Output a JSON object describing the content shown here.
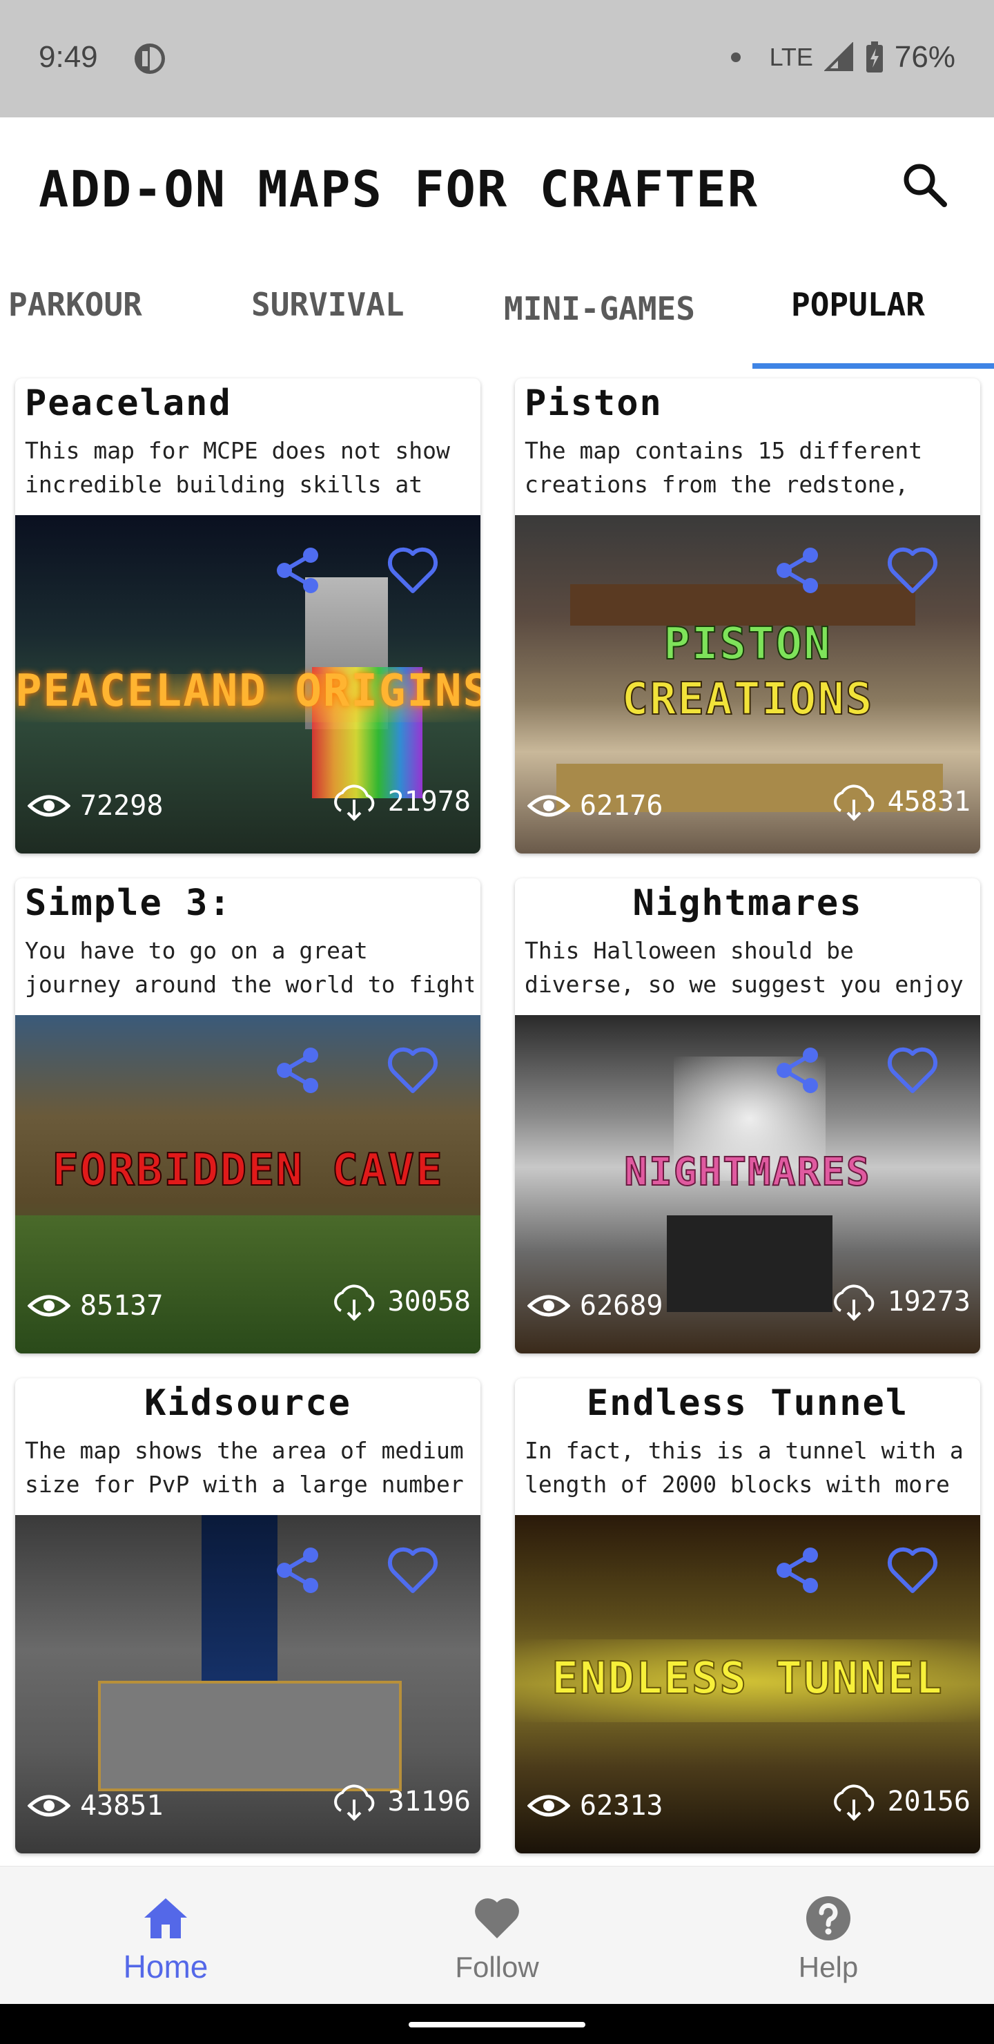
{
  "status_bar": {
    "time": "9:49",
    "network": "LTE",
    "battery": "76%"
  },
  "header": {
    "title": "ADD-ON MAPS FOR CRAFTER"
  },
  "tabs": [
    {
      "label": "PARKOUR",
      "active": false
    },
    {
      "label": "SURVIVAL",
      "active": false
    },
    {
      "label": "MINI-GAMES",
      "active": false
    },
    {
      "label": "POPULAR",
      "active": true
    }
  ],
  "accent_color": "#3f84e5",
  "icon_color": "#4f6df0",
  "cards": [
    {
      "title": "Peaceland",
      "description_line1": "This map for MCPE does not show",
      "description_line2": "incredible building skills at",
      "image_text": "PEACELAND ORIGINS",
      "views": "72298",
      "downloads": "21978"
    },
    {
      "title": "Piston",
      "description_line1": "The map contains 15 different",
      "description_line2": "creations from the redstone,",
      "image_text_line1": "PISTON",
      "image_text_line2": "CREATIONS",
      "views": "62176",
      "downloads": "45831"
    },
    {
      "title": "Simple 3:",
      "description_line1": "You have to go on a great",
      "description_line2": "journey around the world to fight",
      "image_text": "FORBIDDEN CAVE",
      "views": "85137",
      "downloads": "30058"
    },
    {
      "title": "Nightmares",
      "description_line1": "This Halloween should be",
      "description_line2": "diverse, so we suggest you enjoy",
      "image_text": "NIGHTMARES",
      "views": "62689",
      "downloads": "19273"
    },
    {
      "title": "Kidsource",
      "description_line1": "The map shows the area of medium",
      "description_line2": "size for PvP with a large number",
      "views": "43851",
      "downloads": "31196"
    },
    {
      "title": "Endless Tunnel",
      "description_line1": "In fact, this is a tunnel with a",
      "description_line2": "length of 2000 blocks with more",
      "image_text": "ENDLESS TUNNEL",
      "views": "62313",
      "downloads": "20156"
    }
  ],
  "bottom_nav": [
    {
      "label": "Home",
      "icon": "home-icon",
      "active": true
    },
    {
      "label": "Follow",
      "icon": "heart-icon",
      "active": false
    },
    {
      "label": "Help",
      "icon": "help-icon",
      "active": false
    }
  ]
}
